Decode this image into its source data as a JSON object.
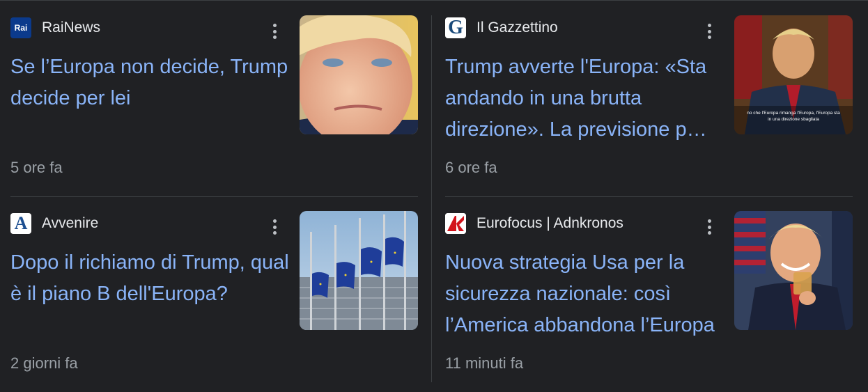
{
  "articles": [
    {
      "source": "RaiNews",
      "logo_text": "Rai",
      "title": "Se l’Europa non decide, Trump decide per lei",
      "time": "5 ore fa",
      "image": "trump-portrait-closeup"
    },
    {
      "source": "Il Gazzettino",
      "logo_text": "G",
      "title": "Trump avverte l'Europa: «Sta andando in una brutta direzione». La previsione p…",
      "time": "6 ore fa",
      "image": "trump-video-still",
      "image_caption": "no che l'Europa rimanga l'Europa, l'Europa sta in una direzione sbagliata"
    },
    {
      "source": "Avvenire",
      "logo_text": "A",
      "title": "Dopo il richiamo di Trump, qual è il piano B dell'Europa?",
      "time": "2 giorni fa",
      "image": "eu-flags-building"
    },
    {
      "source": "Eurofocus | Adnkronos",
      "logo_text": "K",
      "title": "Nuova strategia Usa per la sicurezza nazionale: così l’America abbandona l’Europa",
      "time": "11 minuti fa",
      "image": "trump-smiling-glass"
    }
  ],
  "colors": {
    "background": "#202124",
    "title": "#8ab4f8",
    "source": "#e8eaed",
    "meta": "#9aa0a6",
    "divider": "#3c4043"
  }
}
